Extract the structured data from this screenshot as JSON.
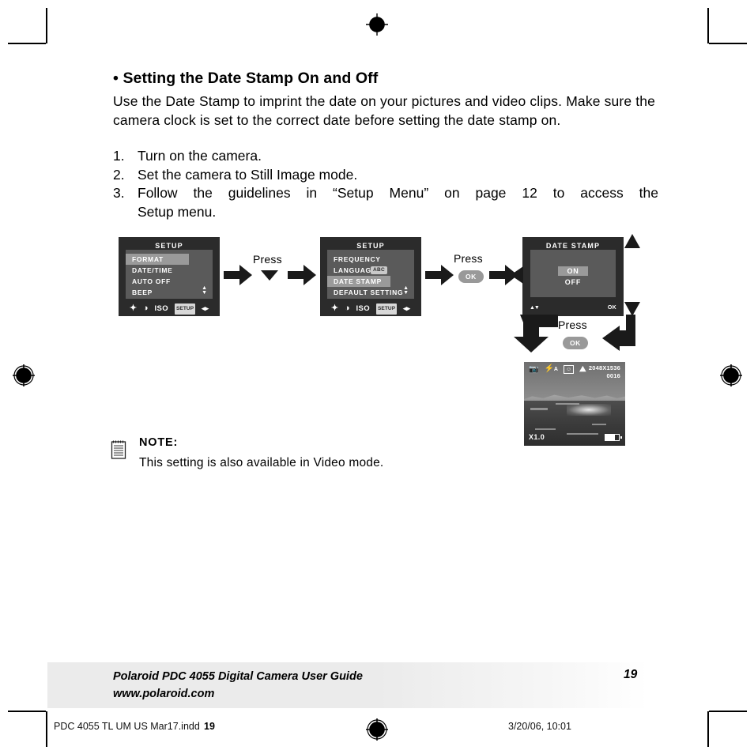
{
  "document": {
    "section_title": "• Setting the Date Stamp On and Off",
    "intro_lines": [
      "Use the Date Stamp to imprint the date on your pictures and video clips.",
      "Make sure the camera clock is set to the correct date before setting the",
      "date stamp on."
    ],
    "steps": [
      {
        "num": "1.",
        "text": "Turn on the camera."
      },
      {
        "num": "2.",
        "text": "Set the camera to Still Image mode."
      },
      {
        "num": "3.",
        "line1": "Follow the guidelines in “Setup Menu” on page 12 to access the",
        "line2": "Setup menu."
      }
    ]
  },
  "diagram": {
    "screen1": {
      "title": "SETUP",
      "rows": [
        {
          "label": "FORMAT",
          "selected": true
        },
        {
          "label": "DATE/TIME",
          "selected": false
        },
        {
          "label": "AUTO OFF",
          "selected": false
        },
        {
          "label": "BEEP",
          "selected": false
        }
      ],
      "scroll_indicator": "▲▼",
      "icon_bar": [
        "white-balance-icon",
        "contrast-icon",
        "ISO",
        "SETUP",
        "left-right-icon"
      ],
      "iso_label": "ISO",
      "setup_tab_label": "SETUP"
    },
    "screen2": {
      "title": "SETUP",
      "rows": [
        {
          "label": "FREQUENCY",
          "selected": false
        },
        {
          "label": "LANGUAGE",
          "selected": false,
          "badge": "ABC"
        },
        {
          "label": "DATE STAMP",
          "selected": true
        },
        {
          "label": "DEFAULT SETTING",
          "selected": false
        }
      ],
      "scroll_indicator": "▲▼",
      "iso_label": "ISO",
      "setup_tab_label": "SETUP"
    },
    "screen3": {
      "title": "DATE STAMP",
      "options": [
        {
          "label": "ON",
          "selected": true
        },
        {
          "label": "OFF",
          "selected": false
        }
      ],
      "footer_left": "▲▼",
      "footer_right": "OK"
    },
    "preview": {
      "icons": [
        "still-camera-icon",
        "flash-auto-icon",
        "portrait-frame-icon",
        "landscape-mountain-icon"
      ],
      "flash_label": "A",
      "resolution": "2048X1536",
      "shots_remaining": "0016",
      "zoom": "X1.0",
      "battery": "battery-icon"
    },
    "press_labels": [
      {
        "id": "press-1",
        "text": "Press",
        "action": "down-arrow"
      },
      {
        "id": "press-2",
        "text": "Press",
        "action": "OK"
      },
      {
        "id": "press-3",
        "text": "Press",
        "action": "OK"
      }
    ],
    "ok_chip_label": "OK"
  },
  "note": {
    "icon": "note-pad-icon",
    "title": "NOTE:",
    "text": "This setting is also available in Video mode."
  },
  "footer": {
    "guide_line1": "Polaroid PDC 4055 Digital Camera User Guide",
    "guide_line2": "www.polaroid.com",
    "page_number": "19",
    "imprint_file": "PDC 4055 TL UM US Mar17.indd",
    "imprint_page": "19",
    "imprint_date": "3/20/06, 10:01"
  },
  "marks": {
    "registration": "registration-target"
  }
}
